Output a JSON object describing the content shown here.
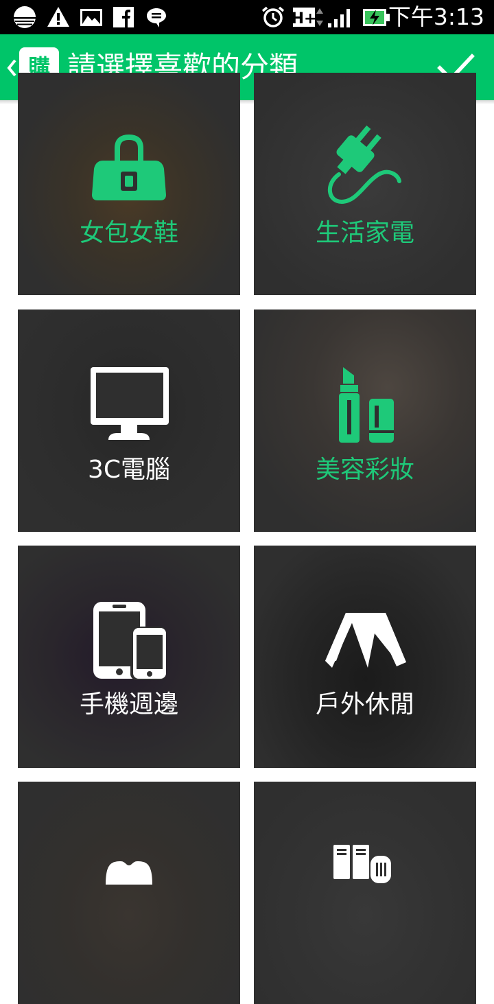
{
  "status_bar": {
    "time": "下午3:13",
    "network_label": "H+",
    "icons": [
      "circle-app-icon",
      "warning-icon",
      "photo-icon",
      "facebook-icon",
      "chat-icon",
      "alarm-icon",
      "network-type-icon",
      "signal-icon",
      "battery-charging-icon"
    ]
  },
  "app_bar": {
    "logo_text": "購",
    "title": "請選擇喜歡的分類",
    "back_icon": "chevron-left-icon",
    "confirm_icon": "checkmark-icon"
  },
  "colors": {
    "accent": "#00c569",
    "tile_background": "#2f2f2f",
    "label_green": "#1ec979",
    "label_white": "#ffffff"
  },
  "categories": [
    {
      "label": "女包女鞋",
      "icon": "handbag-icon",
      "selected": true
    },
    {
      "label": "生活家電",
      "icon": "plug-icon",
      "selected": true
    },
    {
      "label": "3C電腦",
      "icon": "monitor-icon",
      "selected": false
    },
    {
      "label": "美容彩妝",
      "icon": "lipstick-icon",
      "selected": true
    },
    {
      "label": "手機週邊",
      "icon": "phone-tablet-icon",
      "selected": false
    },
    {
      "label": "戶外休閒",
      "icon": "tent-icon",
      "selected": false
    },
    {
      "label": "",
      "icon": "clothing-icon",
      "selected": false
    },
    {
      "label": "",
      "icon": "books-icon",
      "selected": false
    }
  ]
}
